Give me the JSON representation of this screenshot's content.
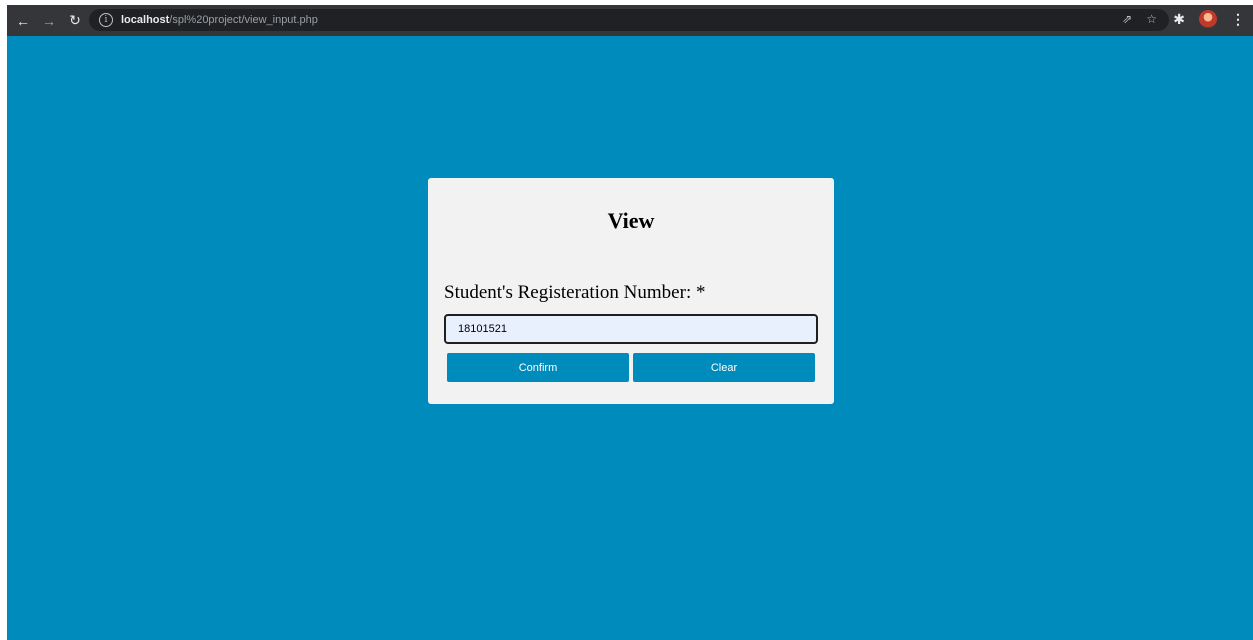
{
  "browser": {
    "url_host": "localhost",
    "url_path": "/spl%20project/view_input.php",
    "info_glyph": "ⓘ"
  },
  "form": {
    "title": "View",
    "label": "Student's Registeration Number: *",
    "registration_value": "18101521",
    "confirm_label": "Confirm",
    "clear_label": "Clear"
  },
  "colors": {
    "page_background": "#008bbd",
    "card_background": "#f2f2f2",
    "button_background": "#008bbd",
    "input_autofill": "#e8f0fe"
  },
  "icons": {
    "back": "back-arrow-icon",
    "forward": "forward-arrow-icon",
    "reload": "reload-icon",
    "share": "share-icon",
    "bookmark": "star-icon",
    "extensions": "puzzle-icon",
    "profile": "avatar",
    "menu": "kebab-menu-icon"
  }
}
